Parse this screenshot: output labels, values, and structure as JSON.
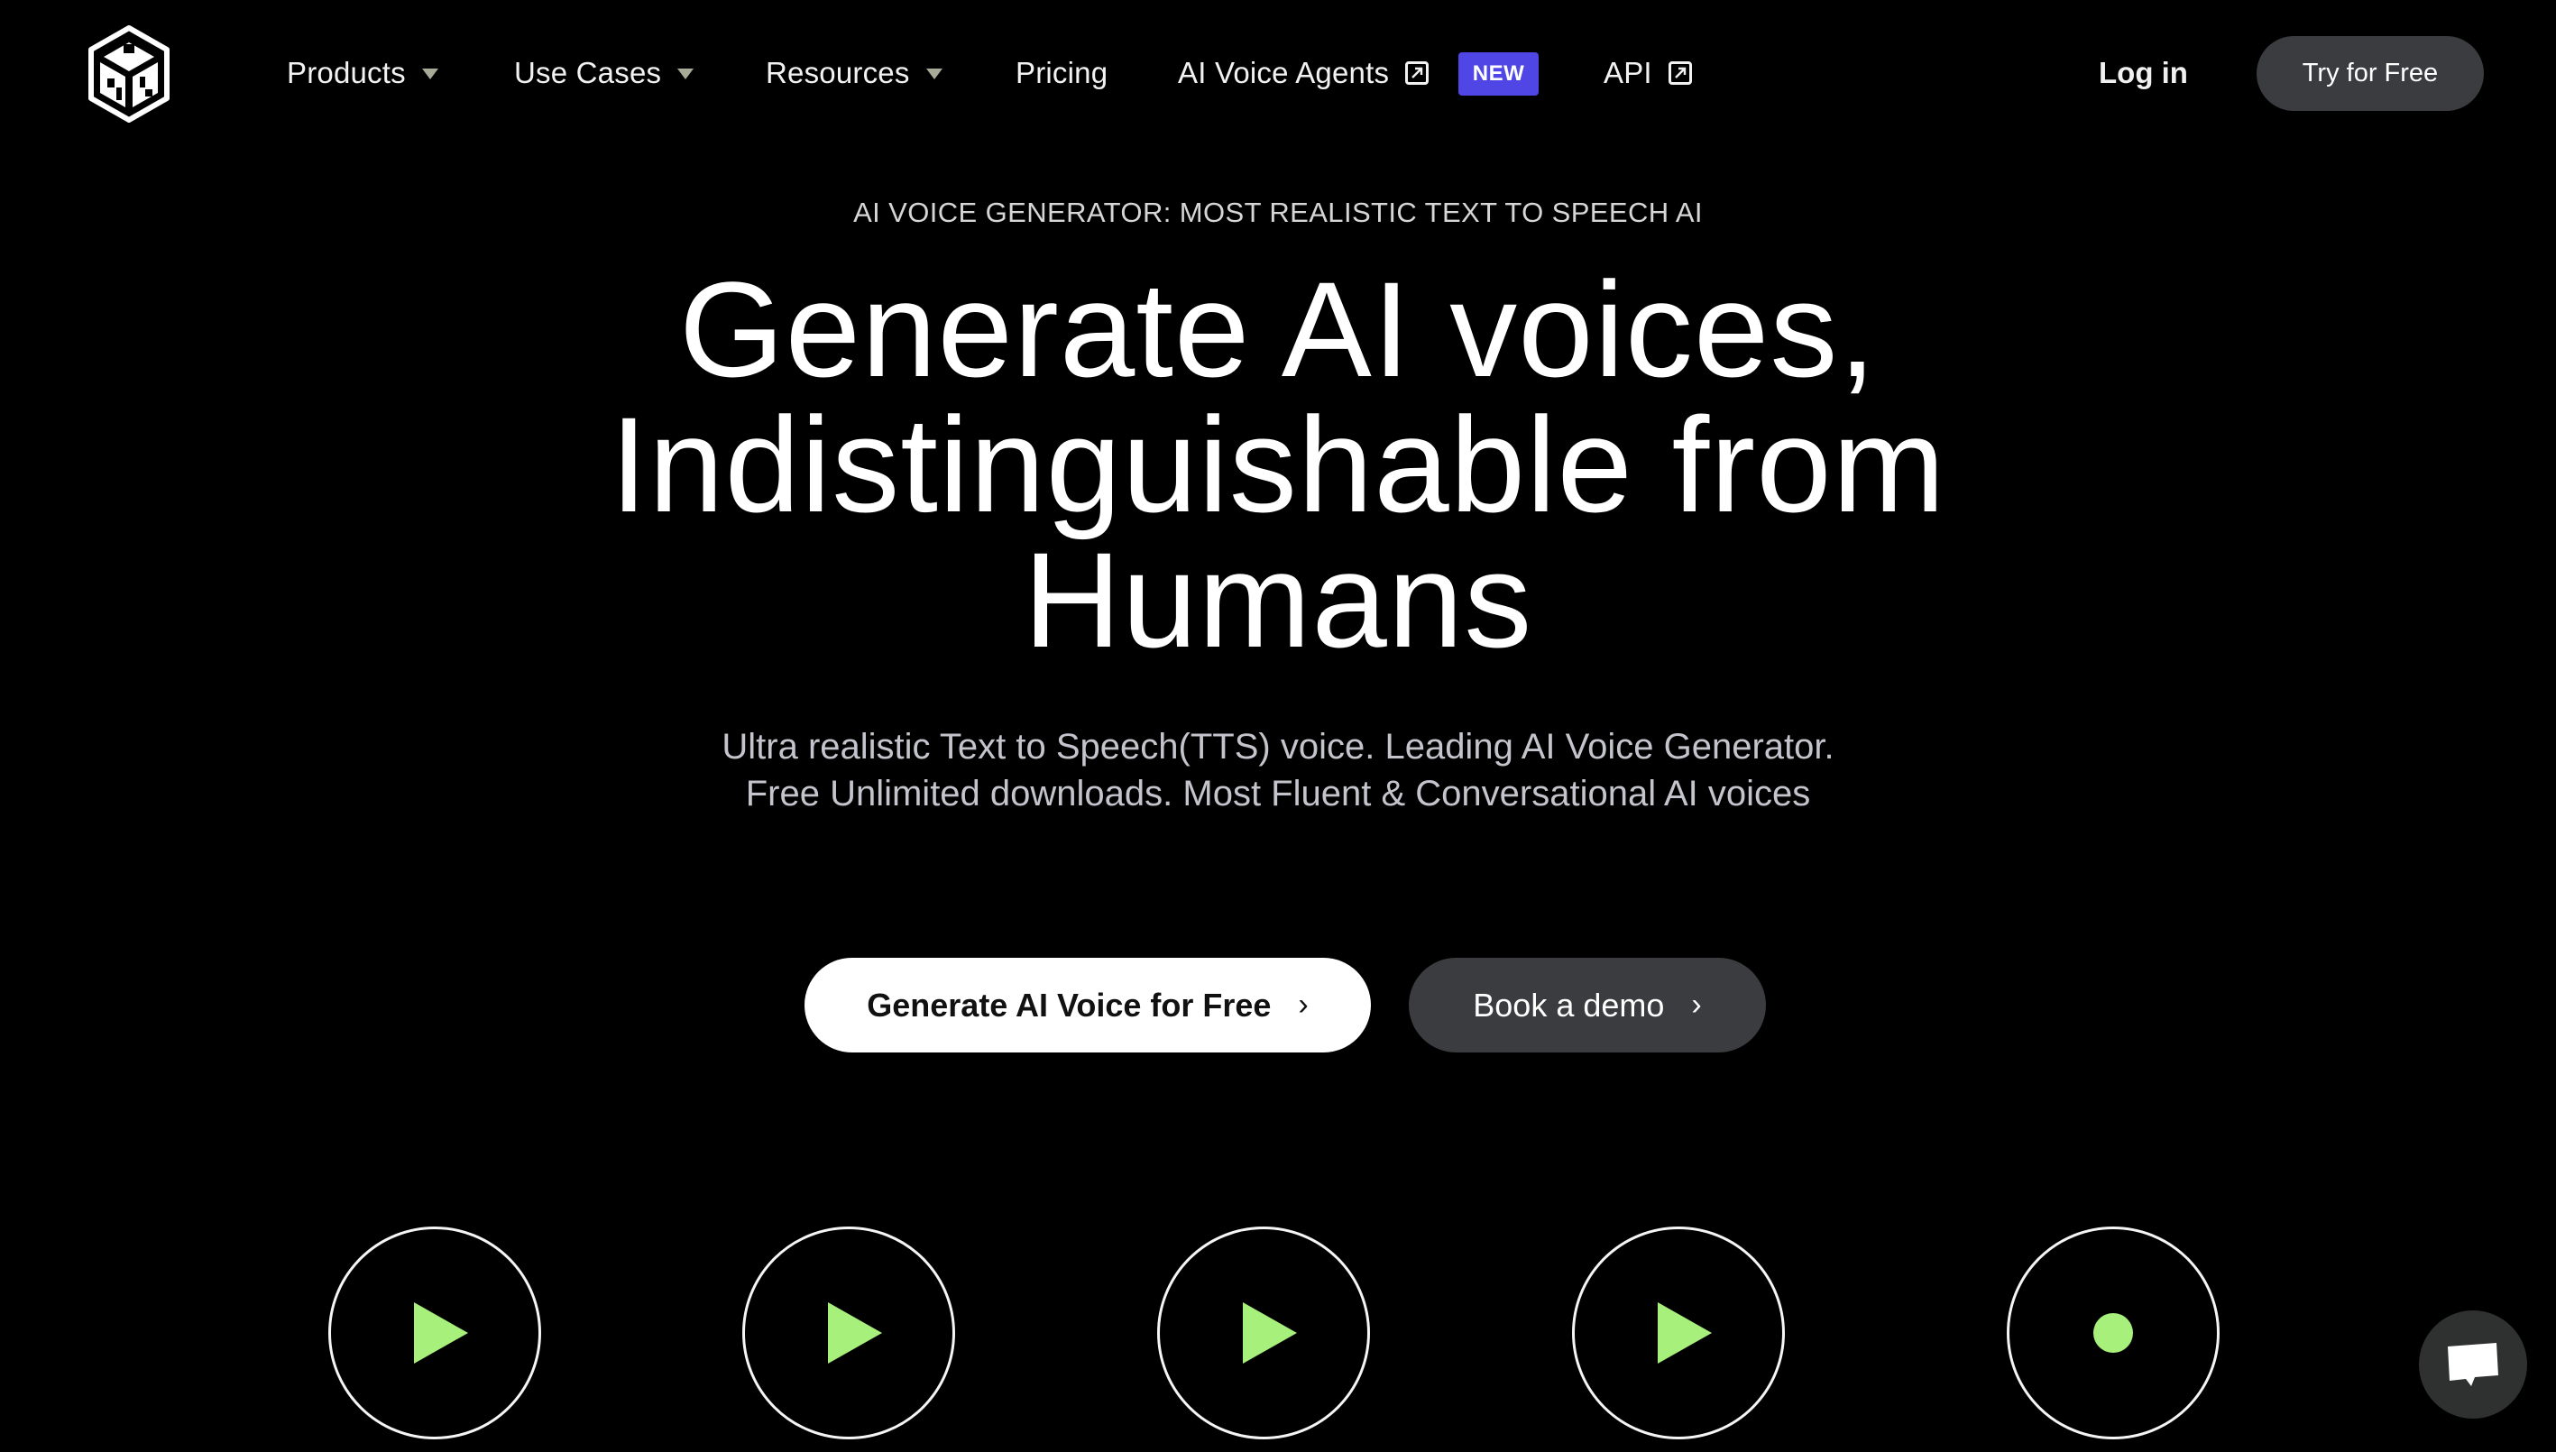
{
  "brand": {
    "logo_icon": "play-ht-cube-logo"
  },
  "nav": {
    "items": [
      {
        "label": "Products",
        "has_dropdown": true
      },
      {
        "label": "Use Cases",
        "has_dropdown": true
      },
      {
        "label": "Resources",
        "has_dropdown": true
      },
      {
        "label": "Pricing",
        "has_dropdown": false
      },
      {
        "label": "AI Voice Agents",
        "external": true,
        "badge": "NEW"
      },
      {
        "label": "API",
        "external": true
      }
    ],
    "login_label": "Log in",
    "cta_label": "Try for Free"
  },
  "hero": {
    "eyebrow": "AI VOICE GENERATOR: MOST REALISTIC TEXT TO SPEECH AI",
    "headline_lines": [
      "Generate AI voices,",
      "Indistinguishable from",
      "Humans"
    ],
    "subtitle_lines": [
      "Ultra realistic Text to Speech(TTS) voice. Leading AI Voice Generator.",
      "Free Unlimited downloads. Most Fluent & Conversational AI voices"
    ],
    "primary_cta": "Generate AI Voice for Free",
    "secondary_cta": "Book a demo",
    "chevron": "›"
  },
  "voice_samples": [
    {
      "icon": "play-icon",
      "state": "idle"
    },
    {
      "icon": "play-icon",
      "state": "idle"
    },
    {
      "icon": "play-icon",
      "state": "idle"
    },
    {
      "icon": "play-icon",
      "state": "idle"
    },
    {
      "icon": "dot-icon",
      "state": "active"
    }
  ],
  "colors": {
    "background": "#000000",
    "accent_green": "#a8f07c",
    "badge_purple": "#4f46e5",
    "button_gray": "#3b3c3f"
  },
  "chat": {
    "icon": "chat-bubble-icon"
  }
}
